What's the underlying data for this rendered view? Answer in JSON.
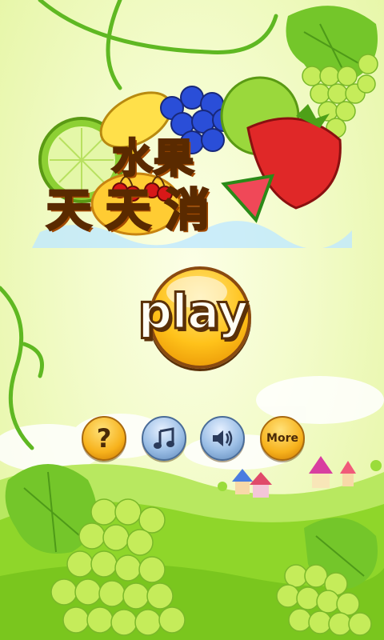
{
  "title": {
    "line1": "水果",
    "line2": "天天消"
  },
  "play_button": {
    "label": "play"
  },
  "buttons": {
    "help": {
      "glyph": "?",
      "icon": "question-mark-icon"
    },
    "music": {
      "icon": "music-note-icon"
    },
    "sound": {
      "icon": "speaker-icon"
    },
    "more": {
      "label": "More"
    }
  },
  "colors": {
    "title_fill": "#ffd21a",
    "title_outline": "#5a2a00",
    "button_orange": "#f7b21c",
    "button_blue": "#9cbfe6",
    "grass": "#8fd62a",
    "vine": "#5fb822"
  }
}
